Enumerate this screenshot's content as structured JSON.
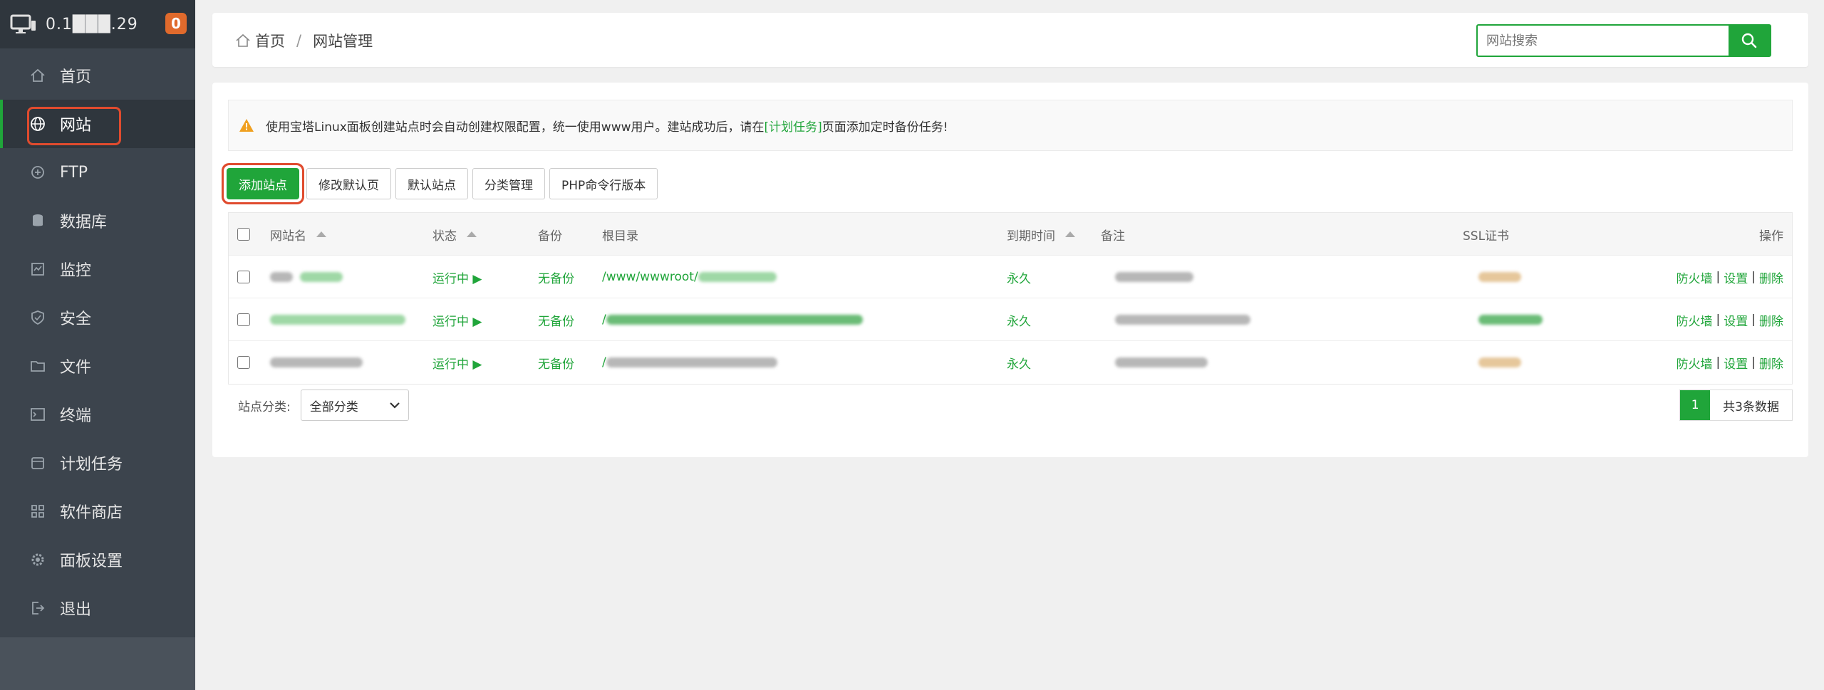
{
  "sidebar": {
    "host": "0.1███.29",
    "badge": "0",
    "items": [
      {
        "label": "首页",
        "icon": "home-icon"
      },
      {
        "label": "网站",
        "icon": "globe-icon"
      },
      {
        "label": "FTP",
        "icon": "ftp-icon"
      },
      {
        "label": "数据库",
        "icon": "database-icon"
      },
      {
        "label": "监控",
        "icon": "monitor-icon"
      },
      {
        "label": "安全",
        "icon": "shield-icon"
      },
      {
        "label": "文件",
        "icon": "folder-icon"
      },
      {
        "label": "终端",
        "icon": "terminal-icon"
      },
      {
        "label": "计划任务",
        "icon": "calendar-icon"
      },
      {
        "label": "软件商店",
        "icon": "grid-icon"
      },
      {
        "label": "面板设置",
        "icon": "gear-icon"
      },
      {
        "label": "退出",
        "icon": "logout-icon"
      }
    ]
  },
  "breadcrumb": {
    "home": "首页",
    "separator": "/",
    "current": "网站管理"
  },
  "search": {
    "placeholder": "网站搜索"
  },
  "notice": {
    "before": "使用宝塔Linux面板创建站点时会自动创建权限配置，统一使用www用户。建站成功后，请在",
    "link": "[计划任务]",
    "after": "页面添加定时备份任务!"
  },
  "toolbar": {
    "add_site": "添加站点",
    "edit_default_page": "修改默认页",
    "default_site": "默认站点",
    "category_manage": "分类管理",
    "php_cli_version": "PHP命令行版本"
  },
  "table": {
    "headers": {
      "name": "网站名",
      "status": "状态",
      "backup": "备份",
      "root": "根目录",
      "expire": "到期时间",
      "remark": "备注",
      "ssl": "SSL证书",
      "ops": "操作"
    },
    "rows": [
      {
        "status": "运行中 ▶",
        "backup": "无备份",
        "root_prefix": "/www/wwwroot/",
        "expire": "永久",
        "ops": [
          "防火墙",
          "设置",
          "删除"
        ]
      },
      {
        "status": "运行中 ▶",
        "backup": "无备份",
        "root_prefix": "/",
        "expire": "永久",
        "ops": [
          "防火墙",
          "设置",
          "删除"
        ]
      },
      {
        "status": "运行中 ▶",
        "backup": "无备份",
        "root_prefix": "/",
        "expire": "永久",
        "ops": [
          "防火墙",
          "设置",
          "删除"
        ]
      }
    ],
    "separator": "|"
  },
  "footer": {
    "category_label": "站点分类:",
    "category_value": "全部分类",
    "page": "1",
    "total": "共3条数据"
  },
  "colors": {
    "accent": "#20a53a",
    "sidebar": "#3c444d",
    "highlight": "#e04b2e",
    "badge": "#e06a2c"
  }
}
